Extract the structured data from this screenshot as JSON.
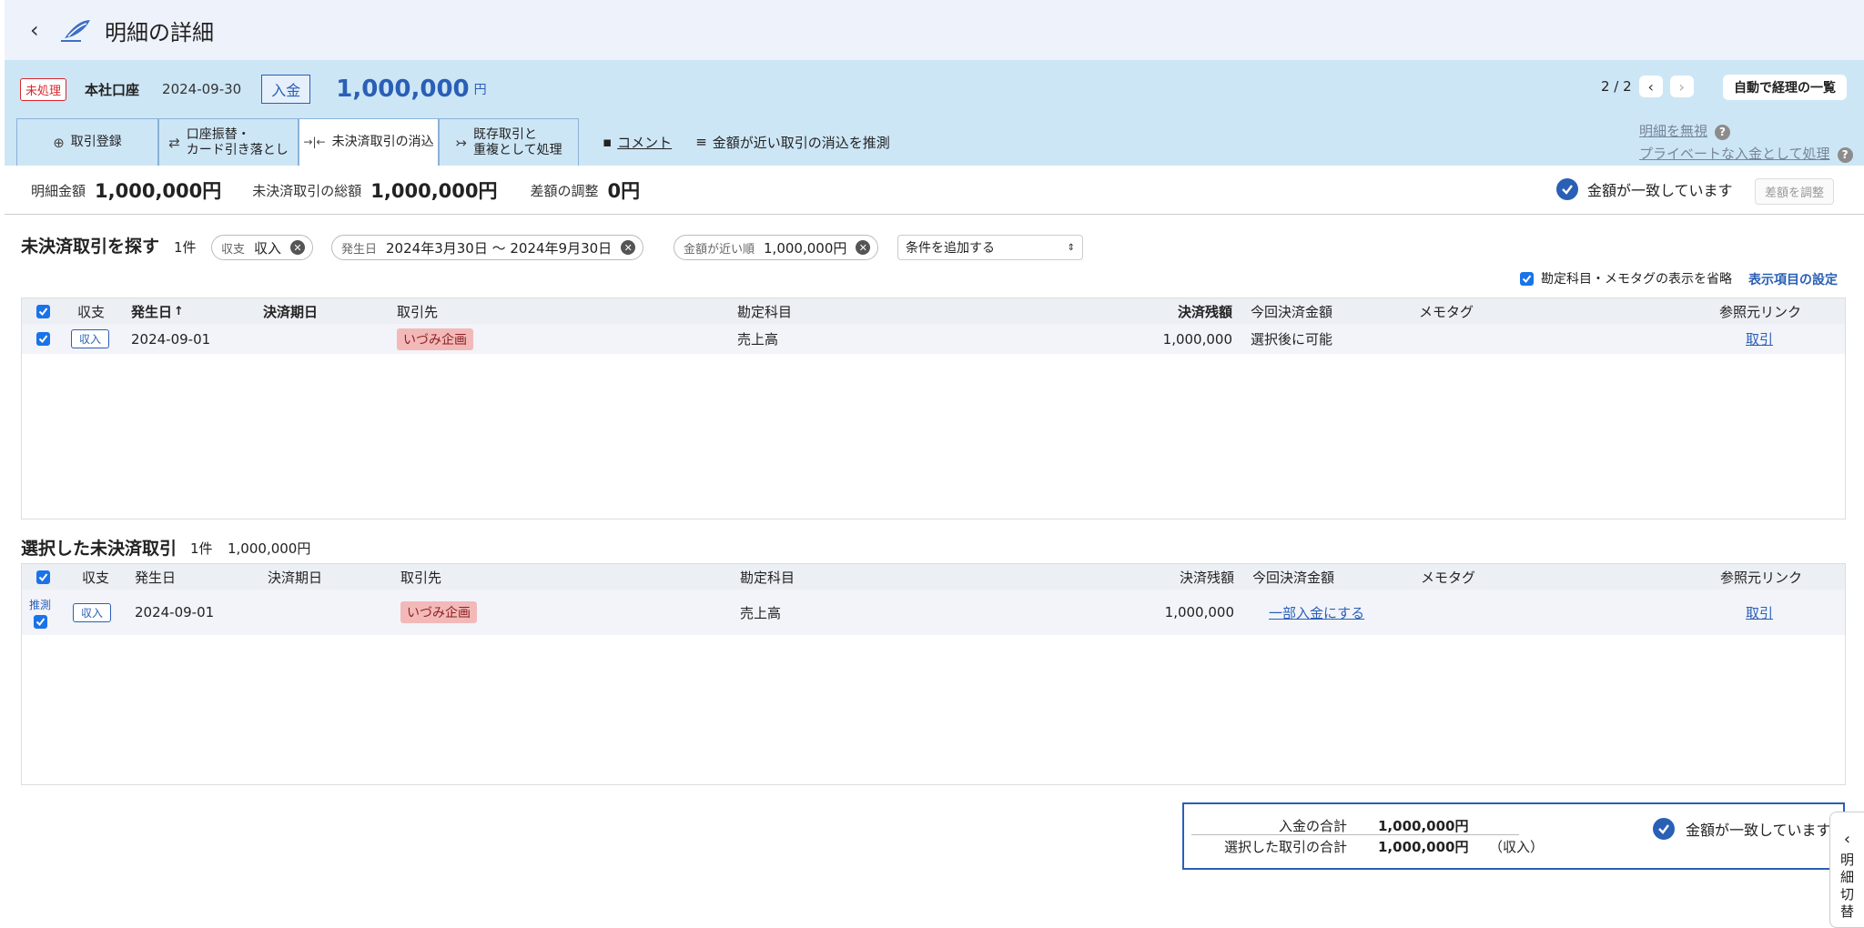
{
  "header": {
    "back": "‹",
    "title": "明細の詳細"
  },
  "statement": {
    "status": "未処理",
    "account": "本社口座",
    "date": "2024-09-30",
    "type": "入金",
    "amount": "1,000,000",
    "unit": "円",
    "pager": "2 / 2",
    "auto_list": "自動で経理の一覧"
  },
  "tabs": [
    {
      "icon": "⊕",
      "label1": "取引登録",
      "label2": ""
    },
    {
      "icon": "⇄",
      "label1": "口座振替・",
      "label2": "カード引き落とし"
    },
    {
      "icon": "→|←",
      "label1": "未決済取引の消込",
      "label2": ""
    },
    {
      "icon": "↣",
      "label1": "既存取引と",
      "label2": "重複として処理"
    }
  ],
  "extra_tabs": {
    "comment": "コメント",
    "guess": "金額が近い取引の消込を推測"
  },
  "side_links": {
    "ignore": "明細を無視",
    "private": "プライベートな入金として処理"
  },
  "totals": {
    "stmt_label": "明細金額",
    "stmt_value": "1,000,000円",
    "unsettled_label": "未決済取引の総額",
    "unsettled_value": "1,000,000円",
    "diff_label": "差額の調整",
    "diff_value": "0円",
    "match": "金額が一致しています",
    "adjust": "差額を調整"
  },
  "search": {
    "title": "未決済取引を探す",
    "count": "1件",
    "chips": [
      {
        "k": "収支",
        "v": "収入"
      },
      {
        "k": "発生日",
        "v": "2024年3月30日 〜 2024年9月30日"
      },
      {
        "k": "金額が近い順",
        "v": "1,000,000円"
      }
    ],
    "add_condition": "条件を追加する",
    "omit": "勘定科目・メモタグの表示を省略",
    "settings": "表示項目の設定"
  },
  "columns": {
    "kind": "収支",
    "date": "発生日",
    "date_sort": "↑",
    "due": "決済期日",
    "partner": "取引先",
    "account": "勘定科目",
    "balance": "決済残額",
    "this_time": "今回決済金額",
    "memo": "メモタグ",
    "ref": "参照元リンク"
  },
  "search_rows": [
    {
      "kind": "収入",
      "date": "2024-09-01",
      "partner": "いづみ企画",
      "account": "売上高",
      "balance": "1,000,000",
      "this_time": "選択後に可能",
      "ref": "取引"
    }
  ],
  "selected": {
    "title": "選択した未決済取引",
    "count": "1件",
    "sum": "1,000,000円",
    "rows": [
      {
        "guess": "推測",
        "kind": "収入",
        "date": "2024-09-01",
        "partner": "いづみ企画",
        "account": "売上高",
        "balance": "1,000,000",
        "this_time": "一部入金にする",
        "ref": "取引"
      }
    ]
  },
  "bottom": {
    "in_label": "入金の合計",
    "in_value": "1,000,000円",
    "sel_label": "選択した取引の合計",
    "sel_value": "1,000,000円",
    "sel_note": "（収入）",
    "match": "金額が一致しています"
  },
  "switch": {
    "arrow": "‹",
    "c1": "明",
    "c2": "細",
    "c3": "切",
    "c4": "替"
  }
}
